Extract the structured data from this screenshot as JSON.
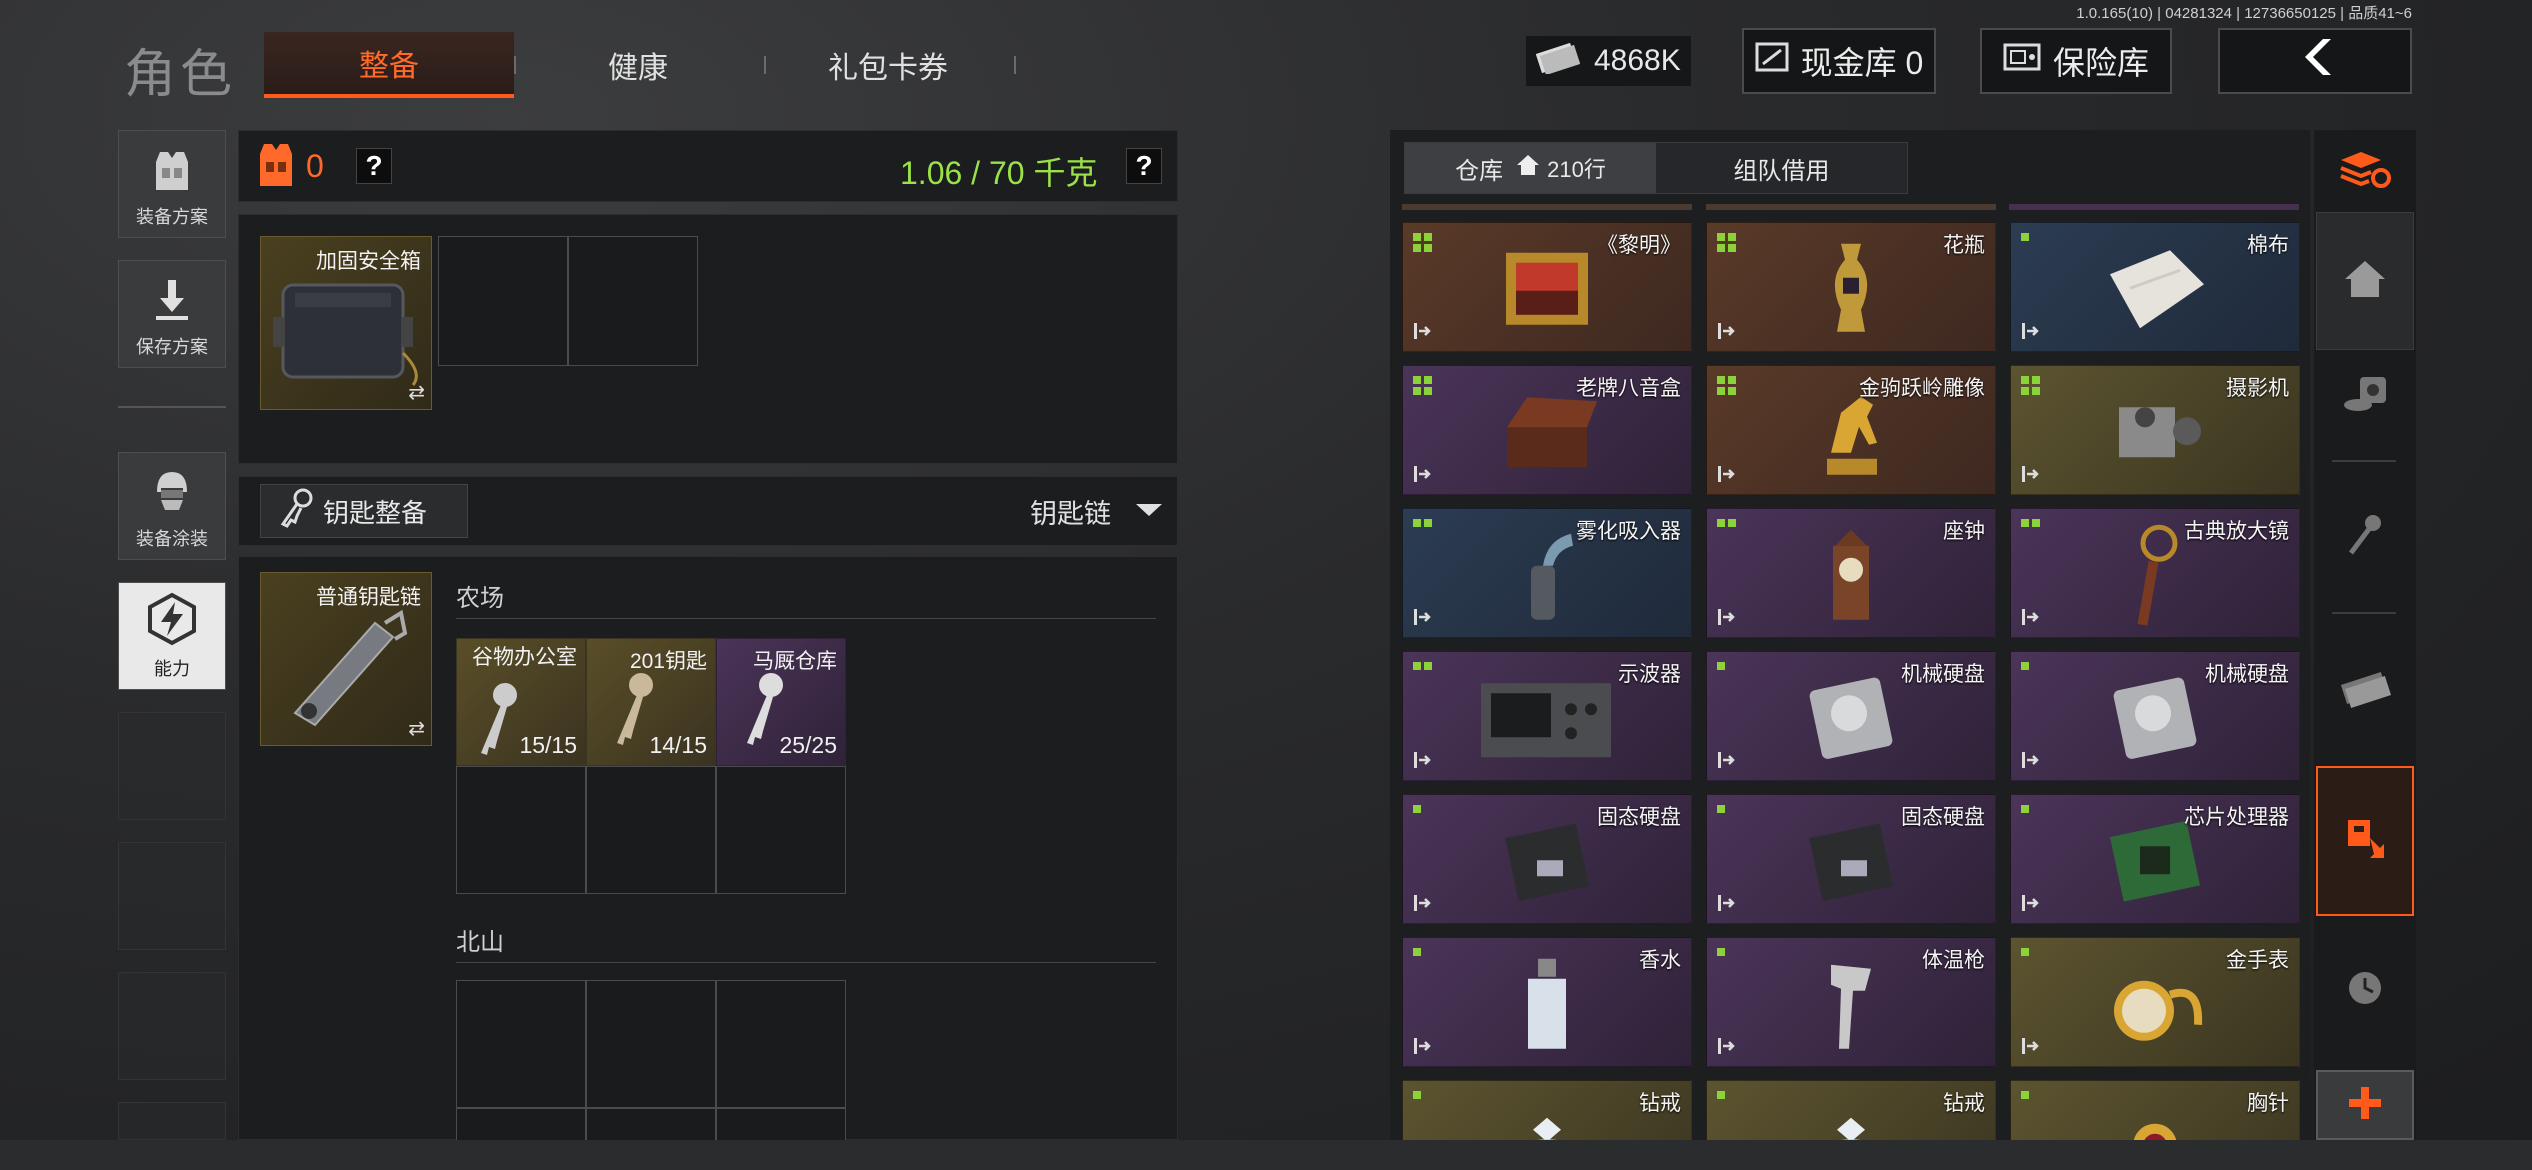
{
  "version": "1.0.165(10) | 04281324 | 12736650125 | 品质41~6",
  "header": {
    "title": "角色",
    "tabs": [
      {
        "label": "整备",
        "active": true
      },
      {
        "label": "健康",
        "active": false
      },
      {
        "label": "礼包卡券",
        "active": false
      }
    ],
    "cash": "4868K",
    "cash_vault_label": "现金库 0",
    "insurance_label": "保险库"
  },
  "sidebar": {
    "items": [
      {
        "label": "装备方案"
      },
      {
        "label": "保存方案"
      },
      {
        "label": "装备涂装"
      },
      {
        "label": "能力"
      }
    ]
  },
  "loadout": {
    "armor_count": "0",
    "help": "?",
    "weight": "1.06 / 70 千克",
    "weight_help": "?",
    "safe_box_label": "加固安全箱",
    "swap_icon": "⇄"
  },
  "keys": {
    "section_button": "钥匙整备",
    "dropdown_label": "钥匙链",
    "keychain_label": "普通钥匙链",
    "groups": [
      {
        "title": "农场",
        "keys": [
          {
            "label": "谷物办公室",
            "count": "15/15"
          },
          {
            "label": "201钥匙",
            "count": "14/15"
          },
          {
            "label": "马厩仓库",
            "count": "25/25"
          }
        ]
      },
      {
        "title": "北山",
        "keys": []
      }
    ]
  },
  "warehouse": {
    "tab_warehouse": "仓库",
    "rows_label": "210行",
    "tab_team": "组队借用",
    "items": [
      {
        "name": "《黎明》",
        "color": "orange",
        "dots": 4,
        "icon": "painting"
      },
      {
        "name": "花瓶",
        "color": "orange",
        "dots": 4,
        "icon": "vase"
      },
      {
        "name": "棉布",
        "color": "blue",
        "dots": 1,
        "icon": "cloth"
      },
      {
        "name": "老牌八音盒",
        "color": "purple",
        "dots": 4,
        "icon": "music-box"
      },
      {
        "name": "金驹跃岭雕像",
        "color": "orange",
        "dots": 4,
        "icon": "horse-statue"
      },
      {
        "name": "摄影机",
        "color": "gold",
        "dots": 4,
        "icon": "camera"
      },
      {
        "name": "雾化吸入器",
        "color": "blue",
        "dots": 2,
        "icon": "inhaler"
      },
      {
        "name": "座钟",
        "color": "purple",
        "dots": 2,
        "icon": "clock"
      },
      {
        "name": "古典放大镜",
        "color": "purple",
        "dots": 2,
        "icon": "magnifier"
      },
      {
        "name": "示波器",
        "color": "purple",
        "dots": 2,
        "icon": "oscilloscope"
      },
      {
        "name": "机械硬盘",
        "color": "purple",
        "dots": 1,
        "icon": "hdd"
      },
      {
        "name": "机械硬盘",
        "color": "purple",
        "dots": 1,
        "icon": "hdd"
      },
      {
        "name": "固态硬盘",
        "color": "purple",
        "dots": 1,
        "icon": "ssd"
      },
      {
        "name": "固态硬盘",
        "color": "purple",
        "dots": 1,
        "icon": "ssd"
      },
      {
        "name": "芯片处理器",
        "color": "purple",
        "dots": 1,
        "icon": "cpu"
      },
      {
        "name": "香水",
        "color": "purple",
        "dots": 1,
        "icon": "perfume"
      },
      {
        "name": "体温枪",
        "color": "purple",
        "dots": 1,
        "icon": "thermometer"
      },
      {
        "name": "金手表",
        "color": "gold",
        "dots": 1,
        "icon": "watch"
      },
      {
        "name": "钻戒",
        "color": "gold",
        "dots": 1,
        "icon": "ring"
      },
      {
        "name": "钻戒",
        "color": "gold",
        "dots": 1,
        "icon": "ring"
      },
      {
        "name": "胸针",
        "color": "gold",
        "dots": 1,
        "icon": "brooch"
      }
    ]
  },
  "colors": {
    "accent": "#ff5a1a",
    "weight_green": "#9be24a",
    "rarity_orange": "#5a3a28",
    "rarity_purple": "#4b3458",
    "rarity_blue": "#2c3c52",
    "rarity_gold": "#5c5430"
  }
}
